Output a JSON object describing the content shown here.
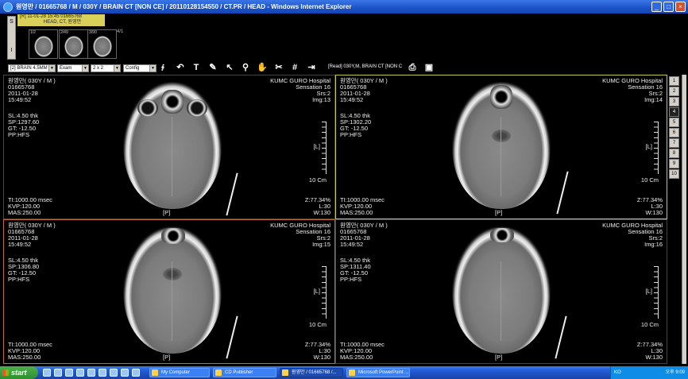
{
  "window": {
    "title": "원영만 / 01665768 / M / 030Y / BRAIN CT [NON CE] / 20110128154550 / CT.PR / HEAD - Windows Internet Explorer"
  },
  "series": {
    "header_line1": "[R] 11-01-28 15:45 01665768",
    "header_line2": "HEAD, CT, 원영만",
    "side_labels": [
      "S",
      "I"
    ],
    "thumbs": [
      "1/2",
      "2/49",
      "3/90",
      "4/1"
    ]
  },
  "toolbar": {
    "series_combo": "[2] BRAIN 4.5MM",
    "exam_combo": "Exam",
    "layout_combo": "2 x 2",
    "config_combo": "Config",
    "read_label": "[Read] 030Y,M, BRAIN CT [NON C"
  },
  "panes": [
    {
      "name": "원영만( 030Y / M )",
      "id": "01665768",
      "date": "2011-01-28",
      "time": "15:49:52",
      "hospital": "KUMC GURO Hospital",
      "device": "Sensation 16",
      "srs": "Srs:2",
      "img": "Img:13",
      "sl": "SL:4.50 thk",
      "sp": "SP:1297.60",
      "gt": "GT: -12.50",
      "pp": "PP:HFS",
      "ti": "TI:1000.00 msec",
      "kvp": "KVP:120.00",
      "mas": "MAS:250.00",
      "zoom": "Z:77.34%",
      "level": "L:30",
      "width": "W:130",
      "p": "[P]",
      "l": "[L]",
      "cm": "10 Cm"
    },
    {
      "name": "원영만( 030Y / M )",
      "id": "01665768",
      "date": "2011-01-28",
      "time": "15:49:52",
      "hospital": "KUMC GURO Hospital",
      "device": "Sensation 16",
      "srs": "Srs:2",
      "img": "Img:14",
      "sl": "SL:4.50 thk",
      "sp": "SP:1302.20",
      "gt": "GT: -12.50",
      "pp": "PP:HFS",
      "ti": "TI:1000.00 msec",
      "kvp": "KVP:120.00",
      "mas": "MAS:250.00",
      "zoom": "Z:77.34%",
      "level": "L:30",
      "width": "W:130",
      "p": "[P]",
      "l": "[L]",
      "cm": "10 Cm"
    },
    {
      "name": "원영만( 030Y / M )",
      "id": "01665768",
      "date": "2011-01-28",
      "time": "15:49:52",
      "hospital": "KUMC GURO Hospital",
      "device": "Sensation 16",
      "srs": "Srs:2",
      "img": "Img:15",
      "sl": "SL:4.50 thk",
      "sp": "SP:1306.80",
      "gt": "GT: -12.50",
      "pp": "PP:HFS",
      "ti": "TI:1000.00 msec",
      "kvp": "KVP:120.00",
      "mas": "MAS:250.00",
      "zoom": "Z:77.34%",
      "level": "L:30",
      "width": "W:130",
      "p": "[P]",
      "l": "[L]",
      "cm": "10 Cm"
    },
    {
      "name": "원영만( 030Y / M )",
      "id": "01665768",
      "date": "2011-01-28",
      "time": "15:49:52",
      "hospital": "KUMC GURO Hospital",
      "device": "Sensation 16",
      "srs": "Srs:2",
      "img": "Img:16",
      "sl": "SL:4.50 thk",
      "sp": "SP:1311.40",
      "gt": "GT: -12.50",
      "pp": "PP:HFS",
      "ti": "TI:1000.00 msec",
      "kvp": "KVP:120.00",
      "mas": "MAS:250.00",
      "zoom": "Z:77.34%",
      "level": "L:30",
      "width": "W:130",
      "p": "[P]",
      "l": "[L]",
      "cm": "10 Cm"
    }
  ],
  "pages": [
    "1",
    "2",
    "3",
    "4",
    "5",
    "6",
    "7",
    "8",
    "9",
    "10"
  ],
  "active_page": "4",
  "taskbar": {
    "start": "start",
    "tasks": [
      "My Computer",
      "CD Publisher",
      "원영만 / 01665768 /...",
      "Microsoft PowerPoint ..."
    ],
    "lang": "KO",
    "clock": "오후 9:09"
  },
  "icons": {
    "ie": "internet-explorer-icon",
    "tools": [
      "rotate-icon",
      "text-icon",
      "edit-icon",
      "pointer-icon",
      "zoom-icon",
      "pan-icon",
      "scissors-icon",
      "grid-icon",
      "export-icon",
      "print-icon",
      "save-icon"
    ]
  }
}
